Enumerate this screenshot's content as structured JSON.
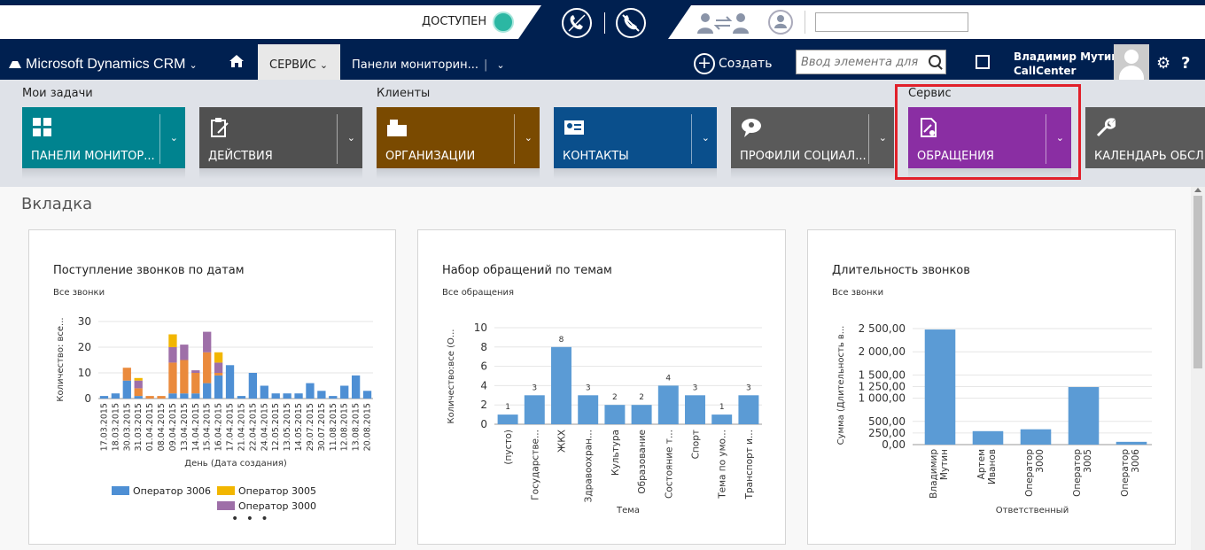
{
  "phonebar": {
    "status": "ДОСТУПЕН",
    "phone_value": ""
  },
  "navbar": {
    "app_title": "Microsoft Dynamics CRM",
    "service_tab": "СЕРВИС",
    "dashboards_tab": "Панели мониторин...",
    "create_label": "Создать",
    "search_placeholder": "Ввод элемента для п",
    "user_name": "Владимир Мутин",
    "user_org": "CallCenter",
    "help": "?"
  },
  "ribbon": {
    "groups": [
      "Мои задачи",
      "Клиенты",
      "Сервис"
    ],
    "tiles": [
      {
        "label": "ПАНЕЛИ МОНИТОР...",
        "color": "#00838f"
      },
      {
        "label": "ДЕЙСТВИЯ",
        "color": "#505050"
      },
      {
        "label": "ОРГАНИЗАЦИИ",
        "color": "#7a4a00"
      },
      {
        "label": "КОНТАКТЫ",
        "color": "#0a4f8c"
      },
      {
        "label": "ПРОФИЛИ СОЦИАЛ...",
        "color": "#5a5a5a"
      },
      {
        "label": "ОБРАЩЕНИЯ",
        "color": "#8a2ea3"
      },
      {
        "label": "КАЛЕНДАРЬ ОБСЛ",
        "color": "#5a5a5a"
      }
    ]
  },
  "main": {
    "tab_title": "Вкладка"
  },
  "chart_data": [
    {
      "type": "bar",
      "stacked": true,
      "title": "Поступление звонков по датам",
      "subtitle": "Все звонки",
      "xlabel": "День (Дата создания)",
      "ylabel": "Количество: все...",
      "ylim": [
        0,
        30
      ],
      "yticks": [
        0,
        10,
        20,
        30
      ],
      "categories": [
        "17.03.2015",
        "18.03.2015",
        "30.03.2015",
        "31.03.2015",
        "01.04.2015",
        "08.04.2015",
        "09.04.2015",
        "13.04.2015",
        "14.04.2015",
        "15.04.2015",
        "16.04.2015",
        "17.04.2015",
        "21.04.2015",
        "22.04.2015",
        "24.04.2015",
        "12.05.2015",
        "13.05.2015",
        "14.05.2015",
        "29.07.2015",
        "30.07.2015",
        "11.08.2015",
        "12.08.2015",
        "13.08.2015",
        "20.08.2015"
      ],
      "series": [
        {
          "name": "Оператор 3006",
          "color": "#4e8fd4",
          "values": [
            1,
            2,
            7,
            1,
            0,
            0,
            2,
            2,
            2,
            6,
            9,
            13,
            1,
            10,
            5,
            2,
            2,
            2,
            6,
            3,
            1,
            5,
            9,
            3
          ]
        },
        {
          "name": "Оператор 3005",
          "color": "#f2b600",
          "values": [
            0,
            0,
            0,
            1,
            0,
            0,
            5,
            0,
            0,
            0,
            4,
            0,
            0,
            0,
            0,
            0,
            0,
            0,
            0,
            0,
            0,
            0,
            0,
            0
          ]
        },
        {
          "name": "Оператор 3000",
          "color": "#9e6fa8",
          "values": [
            0,
            0,
            0,
            3,
            0,
            0,
            6,
            6,
            1,
            8,
            4,
            0,
            0,
            0,
            0,
            0,
            0,
            0,
            0,
            0,
            0,
            0,
            0,
            0
          ]
        },
        {
          "name": "",
          "color": "#ea8a3c",
          "values": [
            0,
            0,
            5,
            3,
            1,
            1,
            12,
            13,
            8,
            12,
            1,
            0,
            0,
            0,
            0,
            0,
            0,
            0,
            0,
            0,
            0,
            0,
            0,
            0
          ]
        }
      ],
      "legend_position": "bottom"
    },
    {
      "type": "bar",
      "title": "Набор обращений по темам",
      "subtitle": "Все обращения",
      "xlabel": "Тема",
      "ylabel": "Количество:все (О...",
      "ylim": [
        0,
        10
      ],
      "yticks": [
        0,
        2,
        4,
        6,
        8,
        10
      ],
      "categories": [
        "(пусто)",
        "Государстве...",
        "ЖКХ",
        "Здравоохран...",
        "Культура",
        "Образование",
        "Состояние т...",
        "Спорт",
        "Тема по умо...",
        "Транспорт и..."
      ],
      "values": [
        1,
        3,
        8,
        3,
        2,
        2,
        4,
        3,
        1,
        3
      ],
      "data_labels": [
        "1",
        "3",
        "8",
        "3",
        "2",
        "2",
        "4",
        "3",
        "1",
        "3"
      ],
      "color": "#5b9bd5"
    },
    {
      "type": "bar",
      "title": "Длительность звонков",
      "subtitle": "Все звонки",
      "xlabel": "Ответственный",
      "ylabel": "Сумма (Длительность в...",
      "ylim": [
        0,
        2500
      ],
      "yticks": [
        "0,00",
        "250,00",
        "500,00",
        "1 000,00",
        "1 250,00",
        "1 500,00",
        "2 000,00",
        "2 500,00"
      ],
      "ytick_values": [
        0,
        250,
        500,
        1000,
        1250,
        1500,
        2000,
        2500
      ],
      "categories": [
        [
          "Владимир",
          "Мутин"
        ],
        [
          "Артем",
          "Иванов"
        ],
        [
          "Оператор",
          "3000"
        ],
        [
          "Оператор",
          "3005"
        ],
        [
          "Оператор",
          "3006"
        ]
      ],
      "values": [
        2480,
        290,
        330,
        1240,
        60
      ],
      "color": "#5b9bd5"
    }
  ]
}
